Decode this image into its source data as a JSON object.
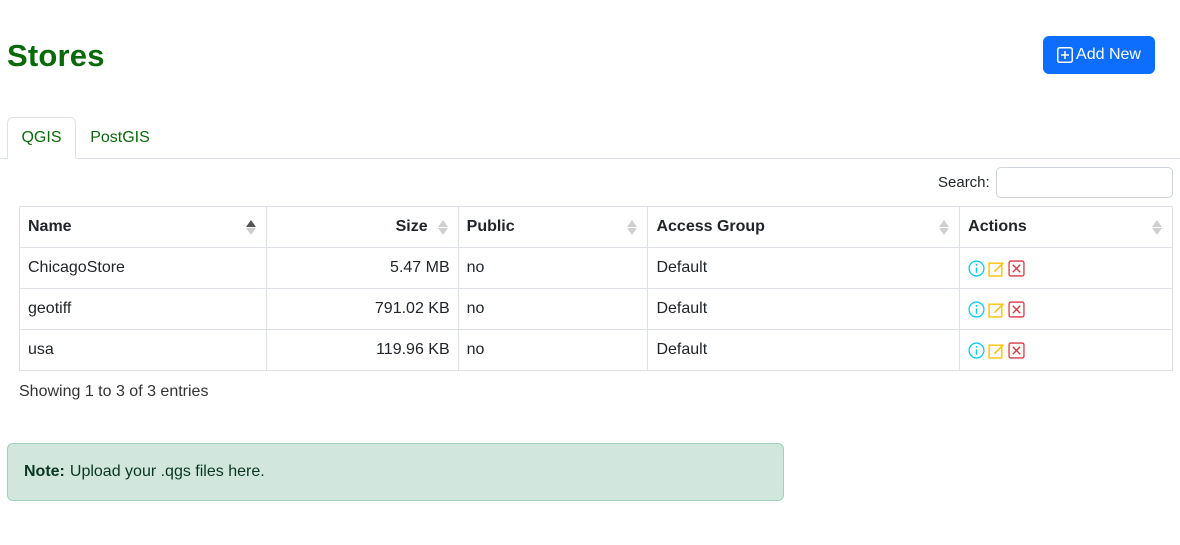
{
  "header": {
    "title": "Stores",
    "add_button_label": "Add New"
  },
  "tabs": [
    {
      "label": "QGIS",
      "active": true
    },
    {
      "label": "PostGIS",
      "active": false
    }
  ],
  "search": {
    "label": "Search:",
    "value": ""
  },
  "table": {
    "columns": [
      "Name",
      "Size",
      "Public",
      "Access Group",
      "Actions"
    ],
    "sort": {
      "column": "Name",
      "direction": "ascending"
    },
    "rows": [
      {
        "name": "ChicagoStore",
        "size": "5.47 MB",
        "public": "no",
        "access_group": "Default"
      },
      {
        "name": "geotiff",
        "size": "791.02 KB",
        "public": "no",
        "access_group": "Default"
      },
      {
        "name": "usa",
        "size": "119.96 KB",
        "public": "no",
        "access_group": "Default"
      }
    ],
    "row_actions": [
      "info-icon",
      "edit-icon",
      "delete-icon"
    ]
  },
  "footer": {
    "entries_info": "Showing 1 to 3 of 3 entries"
  },
  "note": {
    "label": "Note:",
    "text": "Upload your .qgs files here."
  },
  "colors": {
    "title_green": "#0a6a0a",
    "primary": "#0d6efd",
    "info": "#0dcaf0",
    "warning": "#ffc107",
    "danger": "#dc3545",
    "note_bg": "#d1e7dd"
  }
}
